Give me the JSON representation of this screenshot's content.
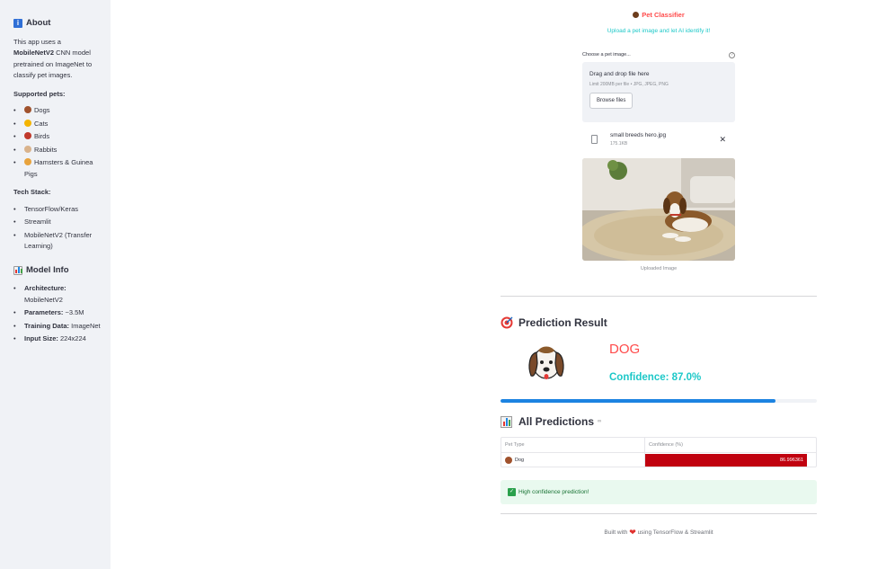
{
  "sidebar": {
    "about_title": "About",
    "about_text_1": "This app uses a ",
    "about_model": "MobileNetV2",
    "about_text_2": " CNN model pretrained on ImageNet to classify pet images.",
    "supported_title": "Supported pets:",
    "pets": [
      "Dogs",
      "Cats",
      "Birds",
      "Rabbits",
      "Hamsters & Guinea Pigs"
    ],
    "tech_title": "Tech Stack:",
    "tech": [
      "TensorFlow/Keras",
      "Streamlit",
      "MobileNetV2 (Transfer Learning)"
    ],
    "model_info_title": "Model Info",
    "model_info": [
      {
        "label": "Architecture:",
        "value": "MobileNetV2"
      },
      {
        "label": "Parameters:",
        "value": "~3.5M"
      },
      {
        "label": "Training Data:",
        "value": "ImageNet"
      },
      {
        "label": "Input Size:",
        "value": "224x224"
      }
    ]
  },
  "header": {
    "title": "Pet Classifier",
    "subtitle": "Upload a pet image and let AI identify it!"
  },
  "uploader": {
    "label": "Choose a pet image...",
    "drop_text": "Drag and drop file here",
    "limit_text": "Limit 200MB per file • JPG, JPEG, PNG",
    "browse_label": "Browse files",
    "file_name": "small breeds hero.jpg",
    "file_size": "175.1KB",
    "image_caption": "Uploaded Image"
  },
  "prediction": {
    "section_title": "Prediction Result",
    "class_label": "DOG",
    "confidence_text": "Confidence: 87.0%",
    "confidence_value": 0.87
  },
  "all_predictions": {
    "section_title": "All Predictions",
    "col_type": "Pet Type",
    "col_conf": "Confidence (%)",
    "rows": [
      {
        "type": "Dog",
        "confidence": "86.996361",
        "fraction": 1.0
      }
    ]
  },
  "success_message": "High confidence prediction!",
  "footer": {
    "prefix": "Built with",
    "suffix": "using TensorFlow & Streamlit"
  },
  "colors": {
    "accent_red": "#ff4b4b",
    "accent_teal": "#1dc8c8",
    "progress_blue": "#1c83e1",
    "bar_red": "#c0020f"
  }
}
